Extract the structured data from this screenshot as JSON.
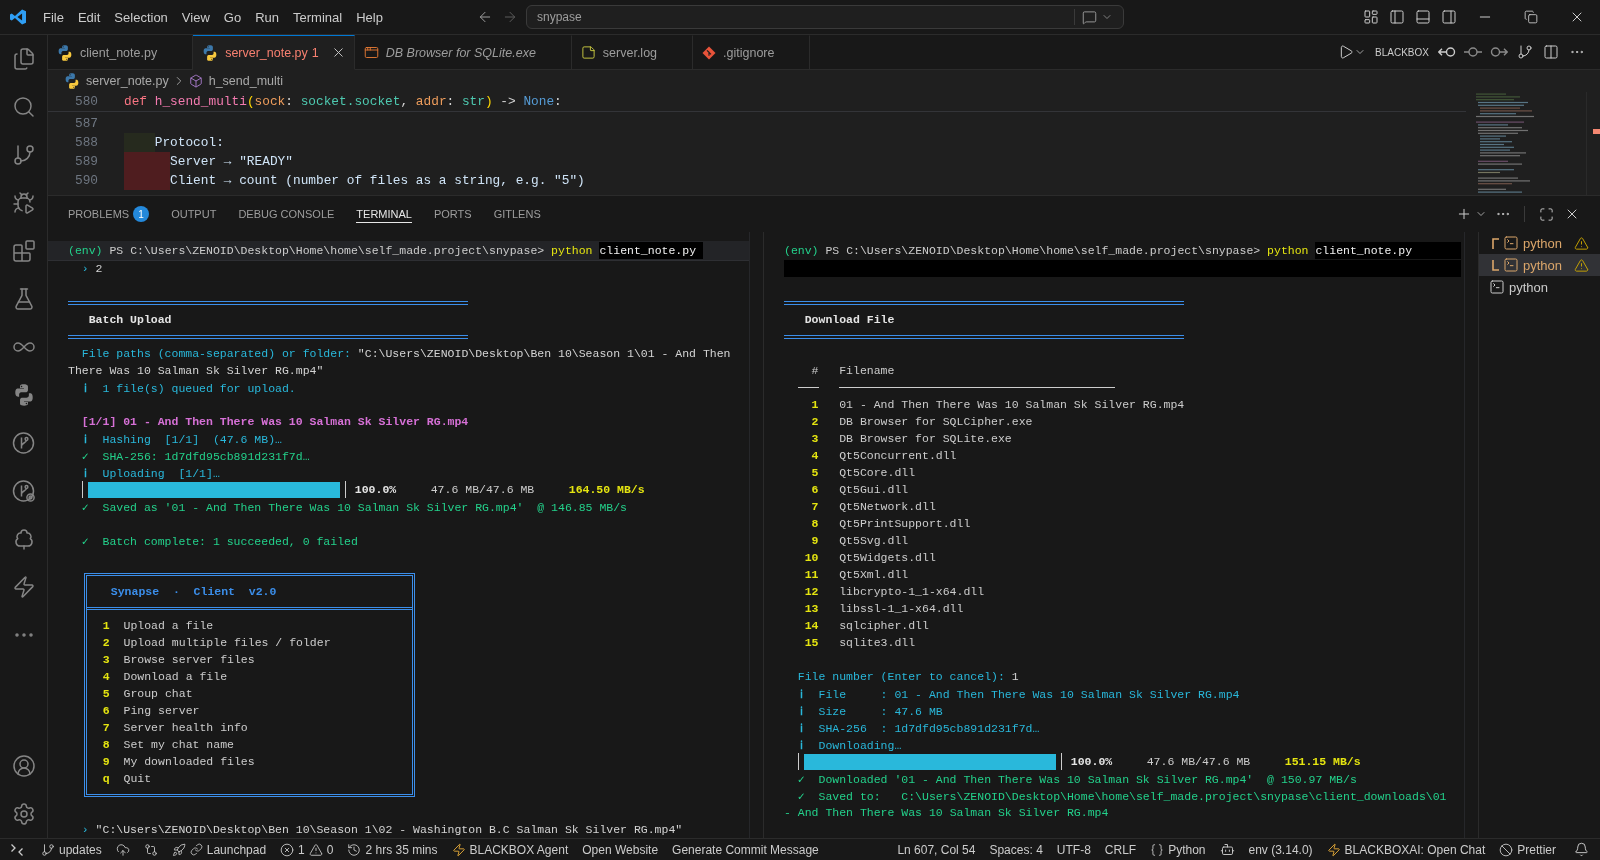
{
  "title_bar": {
    "menu": [
      "File",
      "Edit",
      "Selection",
      "View",
      "Go",
      "Run",
      "Terminal",
      "Help"
    ],
    "command_center": "snypase"
  },
  "tabs": [
    {
      "label": "client_note.py",
      "kind": "python",
      "selected": false,
      "preview": false,
      "error": false
    },
    {
      "label": "server_note.py",
      "kind": "python",
      "selected": true,
      "preview": false,
      "error": true,
      "problems": "1"
    },
    {
      "label": "DB Browser for SQLite.exe",
      "kind": "binary",
      "selected": false,
      "preview": true,
      "error": false
    },
    {
      "label": "server.log",
      "kind": "log",
      "selected": false,
      "preview": false,
      "error": false
    },
    {
      "label": ".gitignore",
      "kind": "git",
      "selected": false,
      "preview": false,
      "error": false
    }
  ],
  "editor_actions": {
    "label": "BLACKBOX"
  },
  "breadcrumb": [
    {
      "label": "server_note.py",
      "kind": "file"
    },
    {
      "label": "h_send_multi",
      "kind": "symbol"
    }
  ],
  "editor": {
    "sticky_line": {
      "number": "580",
      "tokens": [
        {
          "kind": "keyword",
          "text": "def "
        },
        {
          "kind": "function",
          "text": "h_send_multi"
        },
        {
          "kind": "bracket",
          "text": "("
        },
        {
          "kind": "param",
          "text": "sock"
        },
        {
          "kind": "punct",
          "text": ": "
        },
        {
          "kind": "type",
          "text": "socket.socket"
        },
        {
          "kind": "punct",
          "text": ", "
        },
        {
          "kind": "param",
          "text": "addr"
        },
        {
          "kind": "punct",
          "text": ": "
        },
        {
          "kind": "type",
          "text": "str"
        },
        {
          "kind": "bracket",
          "text": ")"
        },
        {
          "kind": "punct",
          "text": " -> "
        },
        {
          "kind": "constant",
          "text": "None"
        },
        {
          "kind": "punct",
          "text": ":"
        }
      ]
    },
    "lines": [
      {
        "number": "587"
      },
      {
        "number": "588",
        "tokens": [
          {
            "kind": "docstring",
            "text": "    Protocol:"
          }
        ]
      },
      {
        "number": "589",
        "tokens": [
          {
            "kind": "docstring",
            "text": "      Server → \"READY\""
          }
        ]
      },
      {
        "number": "590",
        "tokens": [
          {
            "kind": "docstring",
            "text": "      Client → count (number of files as a string, e.g. \"5\")"
          }
        ]
      }
    ]
  },
  "panel": {
    "tabs": [
      {
        "label": "PROBLEMS",
        "badge": "1",
        "selected": false
      },
      {
        "label": "OUTPUT",
        "selected": false
      },
      {
        "label": "DEBUG CONSOLE",
        "selected": false
      },
      {
        "label": "TERMINAL",
        "selected": true
      },
      {
        "label": "PORTS",
        "selected": false
      },
      {
        "label": "GITLENS",
        "selected": false
      }
    ],
    "terminals": [
      {
        "lines": [
          {
            "kind": "prompt",
            "sticky": true,
            "extended_highlight": false,
            "env": "(env)",
            "path": "PS C:\\Users\\ZENOID\\Desktop\\Home\\home\\self_made.project\\snypase>",
            "command": "python",
            "argument": "client_note.py"
          },
          {
            "kind": "echo",
            "marker": "›",
            "text": "2"
          },
          {
            "kind": "blank",
            "highlighted": false
          },
          {
            "kind": "rule"
          },
          {
            "kind": "heading",
            "text": "Batch Upload"
          },
          {
            "kind": "rule"
          },
          {
            "kind": "question",
            "question": "File paths (comma-separated) or folder:",
            "answer": "\"C:\\Users\\ZENOID\\Desktop\\Ben 10\\Season 1\\01 - And Then"
          },
          {
            "kind": "answer_wrap",
            "text": "There Was 10 Salman Sk Silver RG.mp4\""
          },
          {
            "kind": "info",
            "mark": "ℹ",
            "text": "1 file(s) queued for upload."
          },
          {
            "kind": "blank",
            "highlighted": false
          },
          {
            "kind": "task",
            "text": "[1/1] 01 - And Then There Was 10 Salman Sk Silver RG.mp4"
          },
          {
            "kind": "info",
            "mark": "ℹ",
            "text": "Hashing  [1/1]  (47.6 MB)…"
          },
          {
            "kind": "success",
            "mark": "✓",
            "text": "SHA-256: 1d7dfd95cb891d231f7d…"
          },
          {
            "kind": "info",
            "mark": "ℹ",
            "text": "Uploading  [1/1]…"
          },
          {
            "kind": "progress",
            "level": 1,
            "percent": "100.0%",
            "size": "47.6 MB/47.6 MB",
            "speed": "164.50 MB/s"
          },
          {
            "kind": "success",
            "mark": "✓",
            "text": "Saved as '01 - And Then There Was 10 Salman Sk Silver RG.mp4'  @ 146.85 MB/s"
          },
          {
            "kind": "blank",
            "highlighted": false
          },
          {
            "kind": "success",
            "mark": "✓",
            "text": "Batch complete: 1 succeeded, 0 failed"
          },
          {
            "kind": "blank",
            "highlighted": false
          },
          {
            "kind": "menu_box",
            "title": "Synapse  ·  Client  v2.0",
            "items": [
              {
                "key": "1",
                "label": "Upload a file"
              },
              {
                "key": "2",
                "label": "Upload multiple files / folder"
              },
              {
                "key": "3",
                "label": "Browse server files"
              },
              {
                "key": "4",
                "label": "Download a file"
              },
              {
                "key": "5",
                "label": "Group chat"
              },
              {
                "key": "6",
                "label": "Ping server"
              },
              {
                "key": "7",
                "label": "Server health info"
              },
              {
                "key": "8",
                "label": "Set my chat name"
              },
              {
                "key": "9",
                "label": "My downloaded files"
              },
              {
                "key": "q",
                "label": "Quit"
              }
            ]
          },
          {
            "kind": "blank",
            "highlighted": false
          },
          {
            "kind": "echo",
            "marker": "›",
            "text": "\"C:\\Users\\ZENOID\\Desktop\\Ben 10\\Season 1\\02 - Washington B.C Salman Sk Silver RG.mp4\""
          }
        ]
      },
      {
        "lines": [
          {
            "kind": "prompt",
            "sticky": false,
            "extended_highlight": true,
            "env": "(env)",
            "path": "PS C:\\Users\\ZENOID\\Desktop\\Home\\home\\self_made.project\\snypase>",
            "command": "python",
            "argument": "client_note.py"
          },
          {
            "kind": "blank",
            "highlighted": true
          },
          {
            "kind": "blank",
            "highlighted": false
          },
          {
            "kind": "rule"
          },
          {
            "kind": "heading",
            "text": "Download File"
          },
          {
            "kind": "rule"
          },
          {
            "kind": "blank",
            "highlighted": false
          },
          {
            "kind": "table_header",
            "columns": [
              "#",
              "Filename"
            ]
          },
          {
            "kind": "table_rule"
          },
          {
            "kind": "file_row",
            "number": "1",
            "name": "01 - And Then There Was 10 Salman Sk Silver RG.mp4"
          },
          {
            "kind": "file_row",
            "number": "2",
            "name": "DB Browser for SQLCipher.exe"
          },
          {
            "kind": "file_row",
            "number": "3",
            "name": "DB Browser for SQLite.exe"
          },
          {
            "kind": "file_row",
            "number": "4",
            "name": "Qt5Concurrent.dll"
          },
          {
            "kind": "file_row",
            "number": "5",
            "name": "Qt5Core.dll"
          },
          {
            "kind": "file_row",
            "number": "6",
            "name": "Qt5Gui.dll"
          },
          {
            "kind": "file_row",
            "number": "7",
            "name": "Qt5Network.dll"
          },
          {
            "kind": "file_row",
            "number": "8",
            "name": "Qt5PrintSupport.dll"
          },
          {
            "kind": "file_row",
            "number": "9",
            "name": "Qt5Svg.dll"
          },
          {
            "kind": "file_row",
            "number": "10",
            "name": "Qt5Widgets.dll"
          },
          {
            "kind": "file_row",
            "number": "11",
            "name": "Qt5Xml.dll"
          },
          {
            "kind": "file_row",
            "number": "12",
            "name": "libcrypto-1_1-x64.dll"
          },
          {
            "kind": "file_row",
            "number": "13",
            "name": "libssl-1_1-x64.dll"
          },
          {
            "kind": "file_row",
            "number": "14",
            "name": "sqlcipher.dll"
          },
          {
            "kind": "file_row",
            "number": "15",
            "name": "sqlite3.dll"
          },
          {
            "kind": "blank",
            "highlighted": false
          },
          {
            "kind": "question",
            "question": "File number (Enter to cancel):",
            "answer": "1"
          },
          {
            "kind": "info",
            "mark": "ℹ",
            "text": "File     : 01 - And Then There Was 10 Salman Sk Silver RG.mp4"
          },
          {
            "kind": "info",
            "mark": "ℹ",
            "text": "Size     : 47.6 MB"
          },
          {
            "kind": "info",
            "mark": "ℹ",
            "text": "SHA-256  : 1d7dfd95cb891d231f7d…"
          },
          {
            "kind": "info",
            "mark": "ℹ",
            "text": "Downloading…"
          },
          {
            "kind": "progress",
            "level": 1,
            "percent": "100.0%",
            "size": "47.6 MB/47.6 MB",
            "speed": "151.15 MB/s"
          },
          {
            "kind": "success",
            "mark": "✓",
            "text": "Downloaded '01 - And Then There Was 10 Salman Sk Silver RG.mp4'  @ 150.97 MB/s"
          },
          {
            "kind": "success",
            "mark": "✓",
            "text": "Saved to:   C:\\Users\\ZENOID\\Desktop\\Home\\home\\self_made.project\\snypase\\client_downloads\\01"
          },
          {
            "kind": "success_wrap",
            "text": "- And Then There Was 10 Salman Sk Silver RG.mp4"
          }
        ]
      }
    ],
    "terminal_list": [
      {
        "terminals": [
          {
            "label": "python",
            "warning": true,
            "selected": false
          },
          {
            "label": "python",
            "warning": true,
            "selected": true
          }
        ]
      },
      {
        "terminals": [
          {
            "label": "python",
            "warning": false,
            "selected": false
          }
        ]
      }
    ]
  },
  "status_bar": {
    "left": [
      {
        "kind": "remote"
      },
      {
        "kind": "branch",
        "label": "updates"
      },
      {
        "kind": "publish"
      },
      {
        "kind": "compare"
      },
      {
        "kind": "launchpad",
        "label": "Launchpad"
      },
      {
        "kind": "problems",
        "errors": "1",
        "warnings": "0"
      },
      {
        "kind": "timer",
        "label": "2 hrs 35 mins"
      },
      {
        "kind": "agent",
        "label": "BLACKBOX Agent"
      },
      {
        "kind": "plain",
        "label": "Open Website"
      },
      {
        "kind": "plain",
        "label": "Generate Commit Message"
      }
    ],
    "right": [
      {
        "kind": "plain",
        "label": "Ln 607, Col 54"
      },
      {
        "kind": "plain",
        "label": "Spaces: 4"
      },
      {
        "kind": "plain",
        "label": "UTF-8"
      },
      {
        "kind": "plain",
        "label": "CRLF"
      },
      {
        "kind": "language",
        "label": "Python"
      },
      {
        "kind": "copilot"
      },
      {
        "kind": "plain",
        "label": "env (3.14.0)"
      },
      {
        "kind": "agent",
        "label": "BLACKBOXAI: Open Chat"
      },
      {
        "kind": "formatter",
        "label": "Prettier"
      },
      {
        "kind": "notifications"
      }
    ]
  }
}
